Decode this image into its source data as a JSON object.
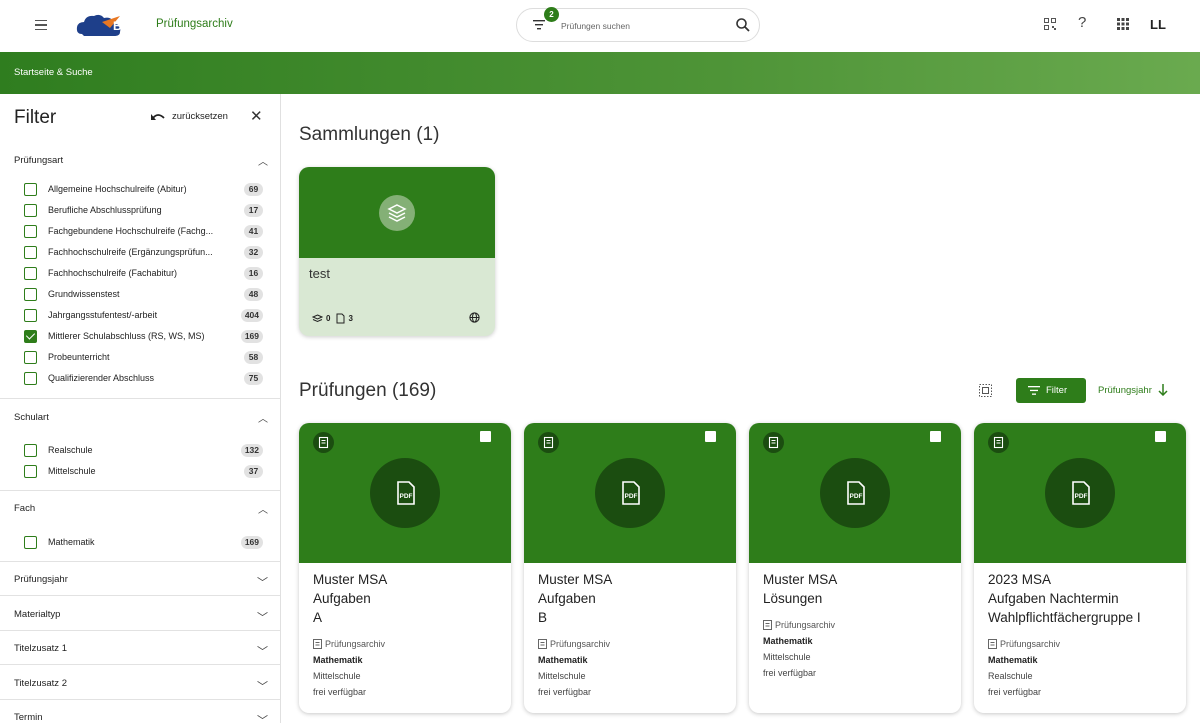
{
  "header": {
    "logo_text": "ByCS",
    "app_name": "Prüfungsarchiv",
    "filter_badge": "2",
    "search_placeholder": "Prüfungen suchen",
    "help_label": "?",
    "user_initials": "LL"
  },
  "banner": {
    "breadcrumb": "Startseite & Suche"
  },
  "sidebar": {
    "title": "Filter",
    "reset_label": "zurücksetzen",
    "sections": [
      {
        "label": "Prüfungsart",
        "options": [
          {
            "label": "Allgemeine Hochschulreife (Abitur)",
            "count": "69",
            "checked": false
          },
          {
            "label": "Berufliche Abschlussprüfung",
            "count": "17",
            "checked": false
          },
          {
            "label": "Fachgebundene Hochschulreife (Fachg...",
            "count": "41",
            "checked": false
          },
          {
            "label": "Fachhochschulreife (Ergänzungsprüfun...",
            "count": "32",
            "checked": false
          },
          {
            "label": "Fachhochschulreife (Fachabitur)",
            "count": "16",
            "checked": false
          },
          {
            "label": "Grundwissenstest",
            "count": "48",
            "checked": false
          },
          {
            "label": "Jahrgangsstufentest/-arbeit",
            "count": "404",
            "checked": false
          },
          {
            "label": "Mittlerer Schulabschluss (RS, WS, MS)",
            "count": "169",
            "checked": true
          },
          {
            "label": "Probeunterricht",
            "count": "58",
            "checked": false
          },
          {
            "label": "Qualifizierender Abschluss",
            "count": "75",
            "checked": false
          }
        ]
      },
      {
        "label": "Schulart",
        "options": [
          {
            "label": "Realschule",
            "count": "132",
            "checked": false
          },
          {
            "label": "Mittelschule",
            "count": "37",
            "checked": false
          }
        ]
      },
      {
        "label": "Fach",
        "options": [
          {
            "label": "Mathematik",
            "count": "169",
            "checked": false
          }
        ]
      }
    ],
    "collapsed": [
      "Prüfungsjahr",
      "Materialtyp",
      "Titelzusatz 1",
      "Titelzusatz 2",
      "Termin"
    ]
  },
  "main": {
    "collections_heading": "Sammlungen (1)",
    "collection": {
      "name": "test",
      "layers_count": "0",
      "docs_count": "3"
    },
    "exams_heading": "Prüfungen (169)",
    "filter_button": "Filter",
    "sort_label": "Prüfungsjahr",
    "cards": [
      {
        "title": [
          "Muster MSA",
          "Aufgaben",
          "A"
        ],
        "source": "Prüfungsarchiv",
        "subject": "Mathematik",
        "school": "Mittelschule",
        "access": "frei verfügbar"
      },
      {
        "title": [
          "Muster MSA",
          "Aufgaben",
          "B"
        ],
        "source": "Prüfungsarchiv",
        "subject": "Mathematik",
        "school": "Mittelschule",
        "access": "frei verfügbar"
      },
      {
        "title": [
          "Muster MSA",
          "Lösungen"
        ],
        "source": "Prüfungsarchiv",
        "subject": "Mathematik",
        "school": "Mittelschule",
        "access": "frei verfügbar"
      },
      {
        "title": [
          "2023 MSA",
          "Aufgaben Nachtermin",
          "Wahlpflichtfächergruppe I"
        ],
        "source": "Prüfungsarchiv",
        "subject": "Mathematik",
        "school": "Realschule",
        "access": "frei verfügbar"
      }
    ]
  },
  "colors": {
    "brand_green": "#2e7d1a",
    "dark_green": "#1b4d10",
    "collection_bg": "#d9e8d3"
  }
}
